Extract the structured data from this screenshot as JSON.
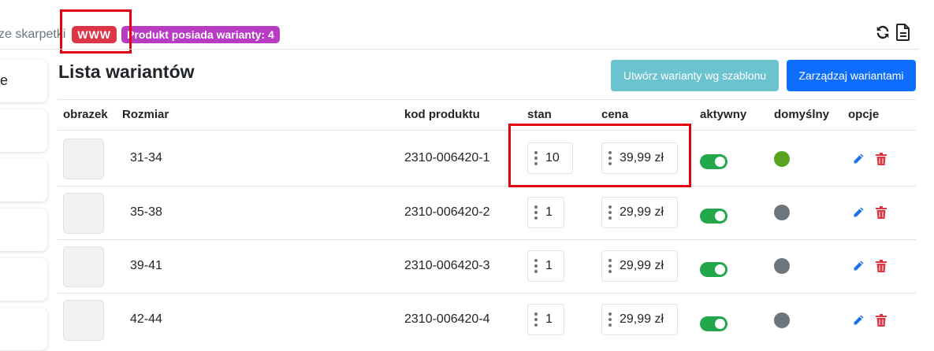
{
  "header": {
    "crumb_text": "ze skarpetki",
    "badge_www": "WWW",
    "badge_variants": "Produkt posiada warianty: 4",
    "icons": [
      "sync-icon",
      "file-icon"
    ]
  },
  "sidebar": {
    "item_letter": "e"
  },
  "main": {
    "title": "Lista wariantów",
    "btn_template": "Utwórz warianty wg szablonu",
    "btn_manage": "Zarządzaj wariantami"
  },
  "table": {
    "columns": [
      "obrazek",
      "Rozmiar",
      "kod produktu",
      "stan",
      "cena",
      "aktywny",
      "domyślny",
      "opcje"
    ],
    "rows": [
      {
        "size": "31-34",
        "code": "2310-006420-1",
        "stock": "10",
        "price": "39,99 zł",
        "active": true,
        "default": true
      },
      {
        "size": "35-38",
        "code": "2310-006420-2",
        "stock": "1",
        "price": "29,99 zł",
        "active": true,
        "default": false
      },
      {
        "size": "39-41",
        "code": "2310-006420-3",
        "stock": "1",
        "price": "29,99 zł",
        "active": true,
        "default": false
      },
      {
        "size": "42-44",
        "code": "2310-006420-4",
        "stock": "1",
        "price": "29,99 zł",
        "active": true,
        "default": false
      }
    ]
  },
  "colors": {
    "accent_primary": "#0d6efd",
    "accent_info": "#6cc3d0",
    "toggle_on": "#22a84a",
    "default_on": "#5aa321",
    "default_off": "#6c757d",
    "danger": "#dc3545",
    "variant_badge": "#b73cc3"
  }
}
